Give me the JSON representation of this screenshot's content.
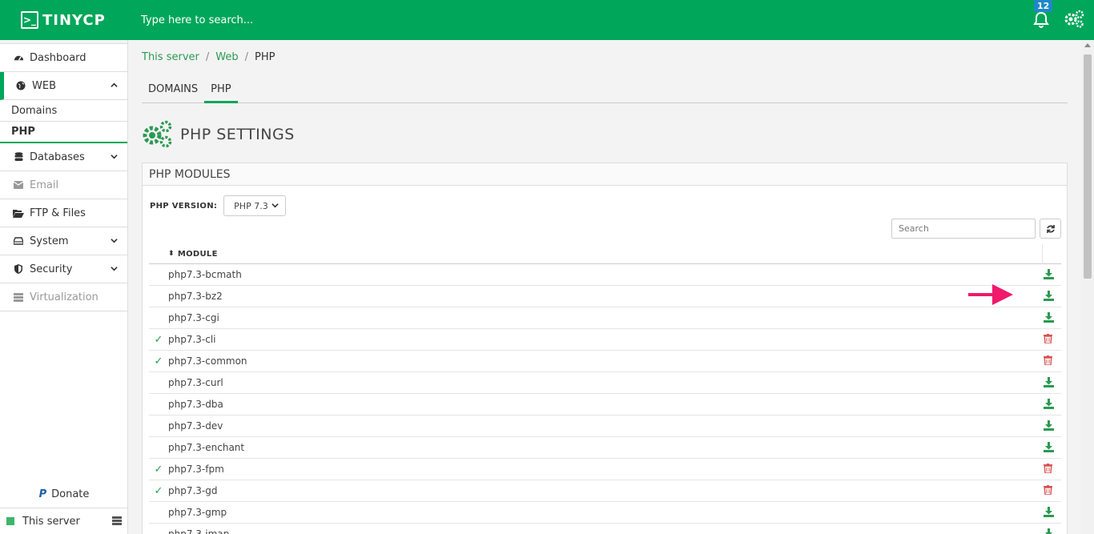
{
  "topbar": {
    "logo_text": "TINYCP",
    "logo_mark": ">_",
    "search_placeholder": "Type here to search...",
    "notifications_count": "12",
    "colors": {
      "brand": "#00a65a"
    }
  },
  "sidebar": {
    "dashboard": "Dashboard",
    "web": "WEB",
    "web_sub": [
      "Domains",
      "PHP"
    ],
    "databases": "Databases",
    "email": "Email",
    "ftp": "FTP & Files",
    "system": "System",
    "security": "Security",
    "virtualization": "Virtualization",
    "donate": "Donate",
    "paypal_mark": "P",
    "server": "This server"
  },
  "breadcrumb": {
    "b1": "This server",
    "b2": "Web",
    "b3": "PHP",
    "sep": "/"
  },
  "tabs": [
    "DOMAINS",
    "PHP"
  ],
  "page_title": "PHP SETTINGS",
  "panel": {
    "title": "PHP MODULES",
    "version_label": "PHP VERSION:",
    "version_selected": "PHP 7.3",
    "search_placeholder": "Search",
    "column_module": "MODULE",
    "rows": [
      {
        "name": "php7.3-bcmath",
        "installed": false
      },
      {
        "name": "php7.3-bz2",
        "installed": false
      },
      {
        "name": "php7.3-cgi",
        "installed": false
      },
      {
        "name": "php7.3-cli",
        "installed": true
      },
      {
        "name": "php7.3-common",
        "installed": true
      },
      {
        "name": "php7.3-curl",
        "installed": false
      },
      {
        "name": "php7.3-dba",
        "installed": false
      },
      {
        "name": "php7.3-dev",
        "installed": false
      },
      {
        "name": "php7.3-enchant",
        "installed": false
      },
      {
        "name": "php7.3-fpm",
        "installed": true
      },
      {
        "name": "php7.3-gd",
        "installed": true
      },
      {
        "name": "php7.3-gmp",
        "installed": false
      },
      {
        "name": "php7.3-imap",
        "installed": false
      }
    ],
    "check_glyph": "✓"
  }
}
